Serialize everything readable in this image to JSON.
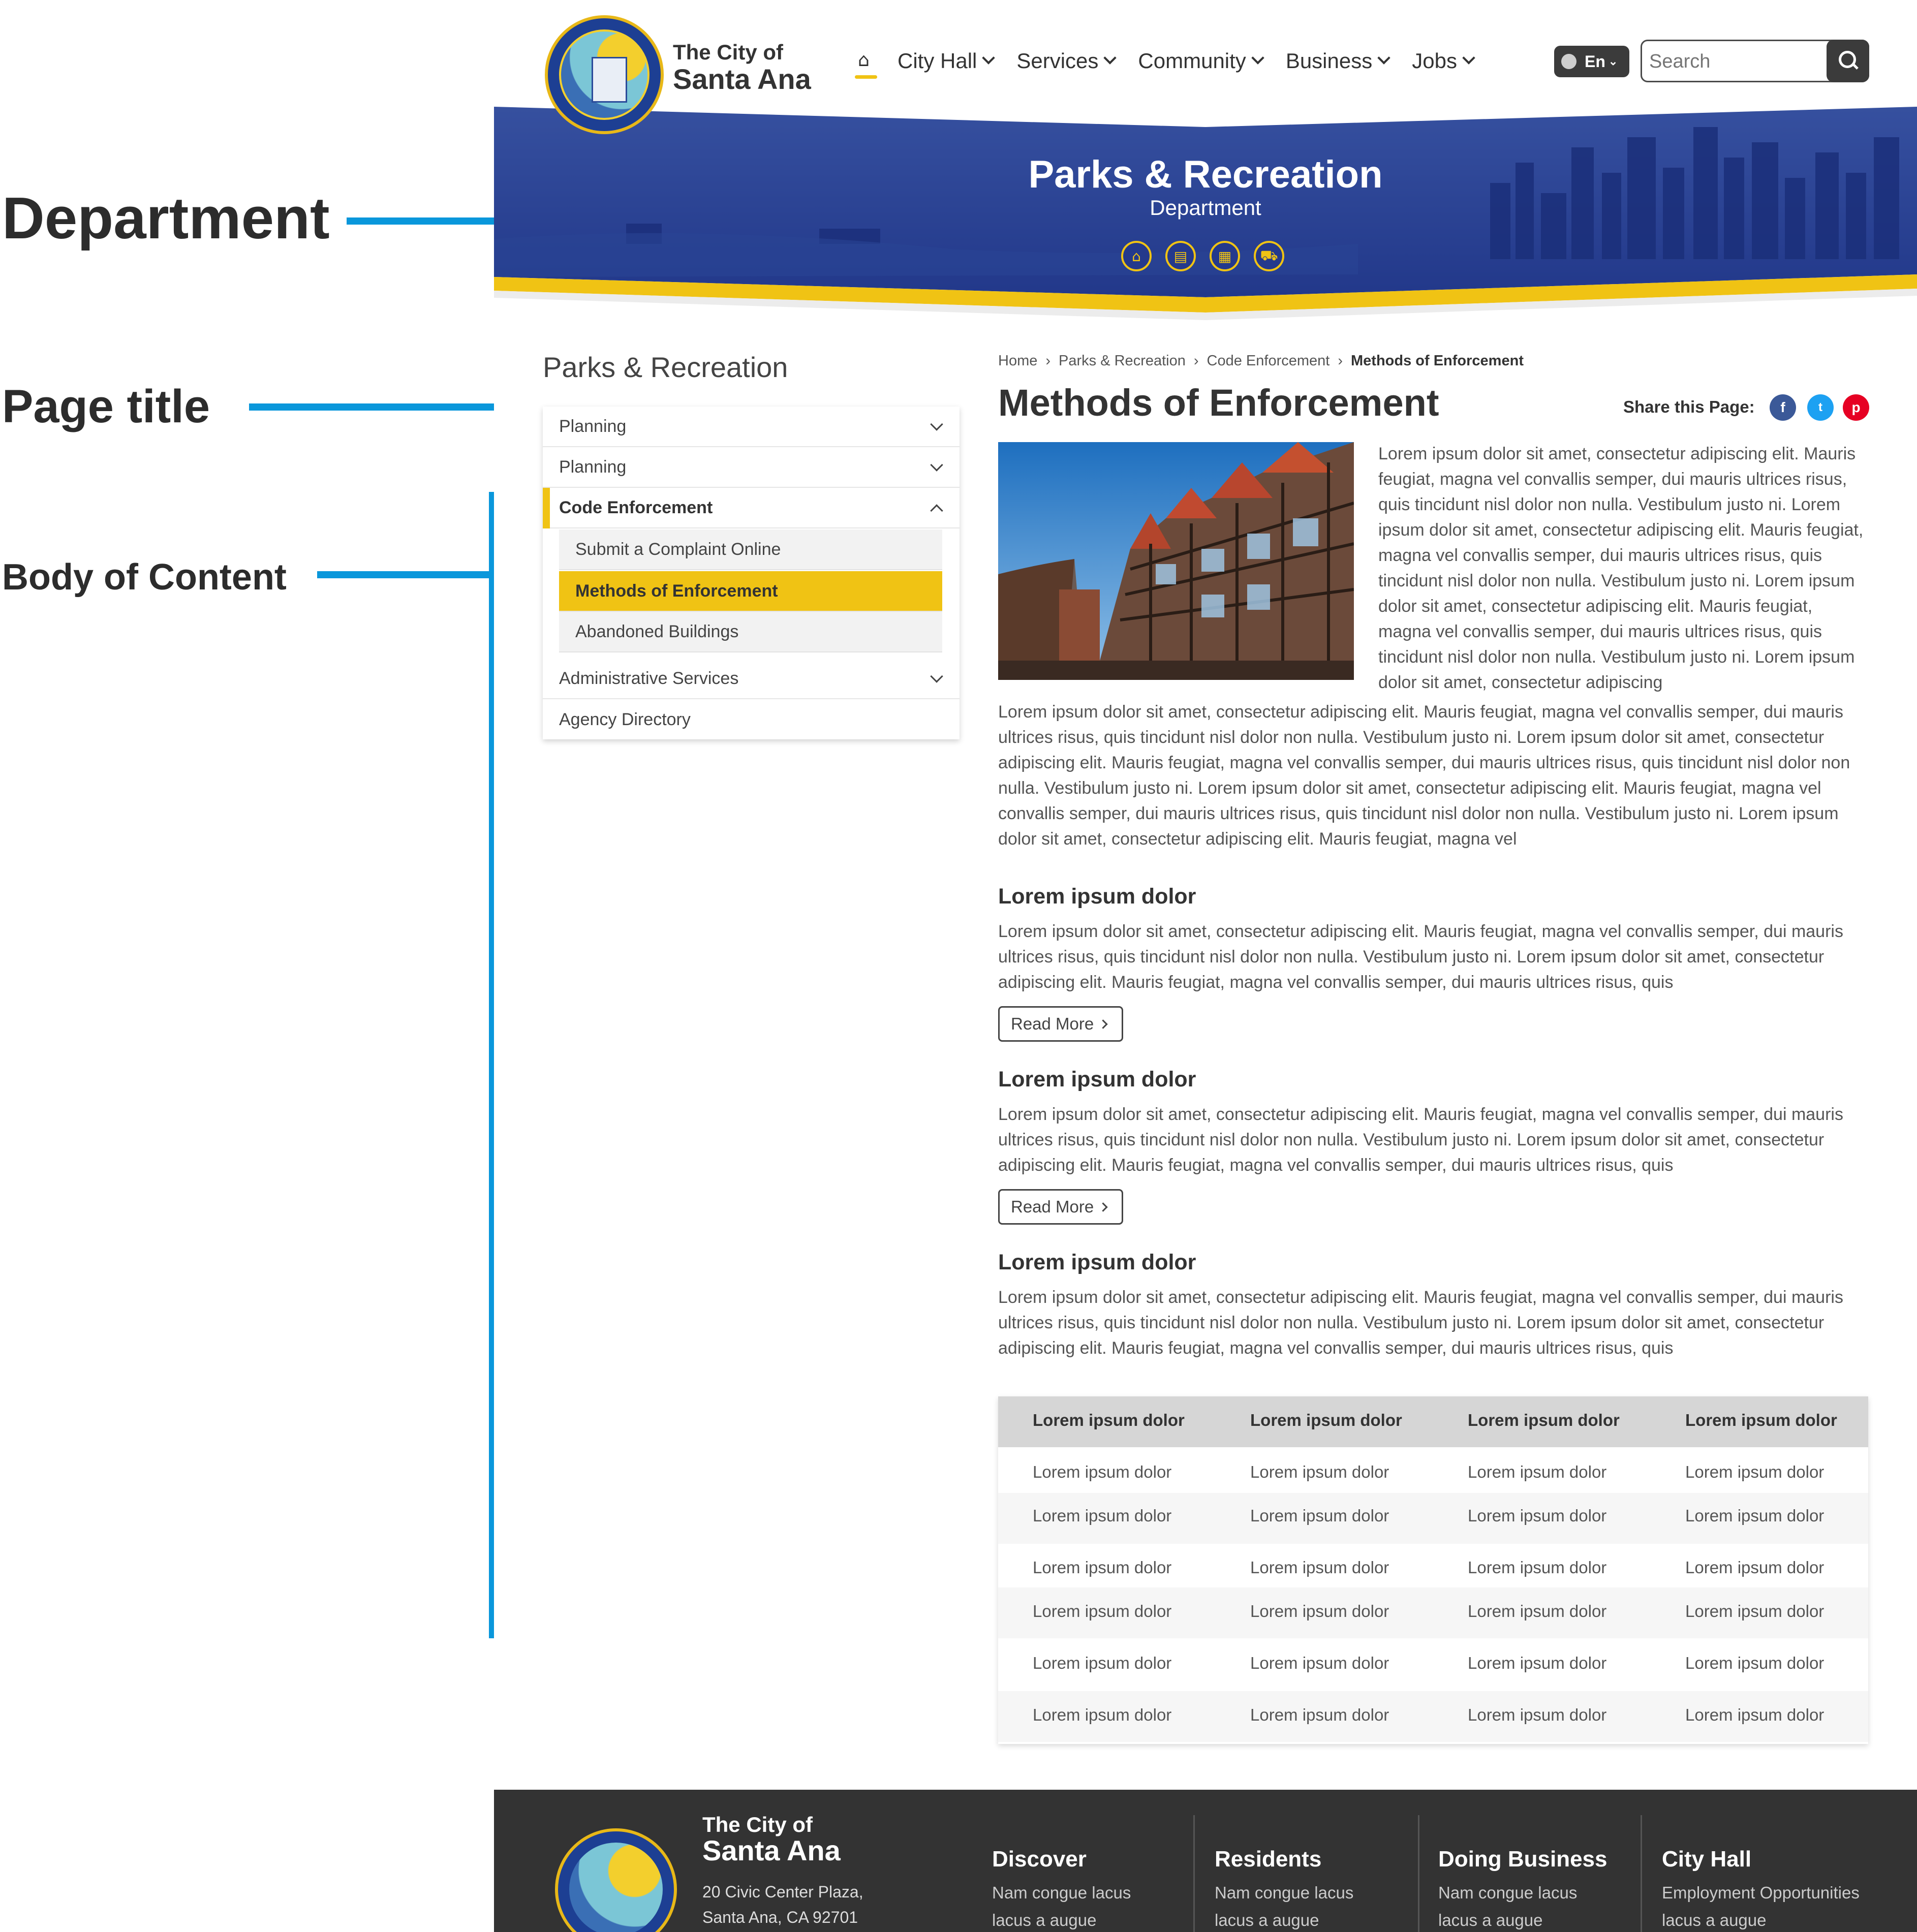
{
  "annotations": {
    "department": "Department",
    "page_title": "Page title",
    "body": "Body of Content"
  },
  "header": {
    "brand_line1": "The City of",
    "brand_line2": "Santa Ana",
    "nav": [
      "City Hall",
      "Services",
      "Community",
      "Business",
      "Jobs"
    ],
    "language": "En",
    "search_placeholder": "Search"
  },
  "banner": {
    "title": "Parks & Recreation",
    "subtitle": "Department",
    "icons": [
      "home-icon",
      "newspaper-icon",
      "calendar-icon",
      "cart-icon"
    ]
  },
  "sidebar": {
    "title": "Parks & Recreation",
    "items": [
      {
        "label": "Planning",
        "state": "collapsed"
      },
      {
        "label": "Planning",
        "state": "collapsed"
      },
      {
        "label": "Code Enforcement",
        "state": "expanded"
      },
      {
        "label": "Administrative Services",
        "state": "collapsed"
      },
      {
        "label": "Agency Directory",
        "state": "none"
      }
    ],
    "subitems": [
      "Submit a Complaint Online",
      "Methods of Enforcement",
      "Abandoned Buildings"
    ],
    "selected_subitem": "Methods of Enforcement"
  },
  "breadcrumb": [
    "Home",
    "Parks & Recreation",
    "Code Enforcement",
    "Methods of Enforcement"
  ],
  "main": {
    "title": "Methods of Enforcement",
    "share_label": "Share this Page:",
    "intro_beside": "Lorem ipsum dolor sit amet, consectetur adipiscing elit. Mauris feugiat, magna vel convallis semper, dui mauris ultrices risus, quis tincidunt nisl dolor non nulla. Vestibulum justo ni. Lorem ipsum dolor sit amet, consectetur adipiscing elit. Mauris feugiat, magna vel convallis semper, dui mauris ultrices risus, quis tincidunt nisl dolor non nulla. Vestibulum justo ni. Lorem ipsum dolor sit amet, consectetur adipiscing elit. Mauris feugiat, magna vel convallis semper, dui mauris ultrices risus, quis tincidunt nisl dolor non nulla. Vestibulum justo ni. Lorem ipsum dolor sit amet, consectetur adipiscing",
    "intro_below": "Lorem ipsum dolor sit amet, consectetur adipiscing elit. Mauris feugiat, magna vel convallis semper, dui mauris ultrices risus, quis tincidunt nisl dolor non nulla. Vestibulum justo ni. Lorem ipsum dolor sit amet, consectetur adipiscing elit. Mauris feugiat, magna vel convallis semper, dui mauris ultrices risus, quis tincidunt nisl dolor non nulla. Vestibulum justo ni. Lorem ipsum dolor sit amet, consectetur adipiscing elit. Mauris feugiat, magna vel convallis semper, dui mauris ultrices risus, quis tincidunt nisl dolor non nulla. Vestibulum justo ni. Lorem ipsum dolor sit amet, consectetur adipiscing elit. Mauris feugiat, magna vel",
    "sections": [
      {
        "heading": "Lorem ipsum dolor",
        "text": "Lorem ipsum dolor sit amet, consectetur adipiscing elit. Mauris feugiat, magna vel convallis semper, dui mauris ultrices risus, quis tincidunt nisl dolor non nulla. Vestibulum justo ni. Lorem ipsum dolor sit amet, consectetur adipiscing elit. Mauris feugiat, magna vel convallis semper, dui mauris ultrices risus, quis",
        "button": "Read More"
      },
      {
        "heading": "Lorem ipsum dolor",
        "text": "Lorem ipsum dolor sit amet, consectetur adipiscing elit. Mauris feugiat, magna vel convallis semper, dui mauris ultrices risus, quis tincidunt nisl dolor non nulla. Vestibulum justo ni. Lorem ipsum dolor sit amet, consectetur adipiscing elit. Mauris feugiat, magna vel convallis semper, dui mauris ultrices risus, quis",
        "button": "Read More"
      },
      {
        "heading": "Lorem ipsum dolor",
        "text": "Lorem ipsum dolor sit amet, consectetur adipiscing elit. Mauris feugiat, magna vel convallis semper, dui mauris ultrices risus, quis tincidunt nisl dolor non nulla. Vestibulum justo ni. Lorem ipsum dolor sit amet, consectetur adipiscing elit. Mauris feugiat, magna vel convallis semper, dui mauris ultrices risus, quis"
      }
    ],
    "table": {
      "headers": [
        "Lorem ipsum dolor",
        "Lorem ipsum dolor",
        "Lorem ipsum dolor",
        "Lorem ipsum dolor"
      ],
      "rows": [
        [
          "Lorem ipsum dolor",
          "Lorem ipsum dolor",
          "Lorem ipsum dolor",
          "Lorem ipsum dolor"
        ],
        [
          "Lorem ipsum dolor",
          "Lorem ipsum dolor",
          "Lorem ipsum dolor",
          "Lorem ipsum dolor"
        ],
        [
          "Lorem ipsum dolor",
          "Lorem ipsum dolor",
          "Lorem ipsum dolor",
          "Lorem ipsum dolor"
        ],
        [
          "Lorem ipsum dolor",
          "Lorem ipsum dolor",
          "Lorem ipsum dolor",
          "Lorem ipsum dolor"
        ],
        [
          "Lorem ipsum dolor",
          "Lorem ipsum dolor",
          "Lorem ipsum dolor",
          "Lorem ipsum dolor"
        ],
        [
          "Lorem ipsum dolor",
          "Lorem ipsum dolor",
          "Lorem ipsum dolor",
          "Lorem ipsum dolor"
        ]
      ]
    }
  },
  "footer": {
    "brand_line1": "The City of",
    "brand_line2": "Santa Ana",
    "address_line1": "20 Civic Center Plaza,",
    "address_line2": "Santa Ana, CA 92701",
    "columns": [
      {
        "title": "Discover",
        "line1": "Nam congue lacus",
        "line2": "lacus a augue"
      },
      {
        "title": "Residents",
        "line1": "Nam congue lacus",
        "line2": "lacus a augue"
      },
      {
        "title": "Doing Business",
        "line1": "Nam congue lacus",
        "line2": "lacus a augue"
      },
      {
        "title": "City Hall",
        "line1": "Employment Opportunities",
        "line2": "lacus a augue"
      }
    ]
  },
  "colors": {
    "accent_yellow": "#f0c314",
    "banner_blue": "#24398c",
    "annotation_blue": "#0a97db",
    "footer_bg": "#333333",
    "facebook": "#3b5998",
    "twitter": "#1da1f2",
    "pinterest": "#e60023"
  }
}
